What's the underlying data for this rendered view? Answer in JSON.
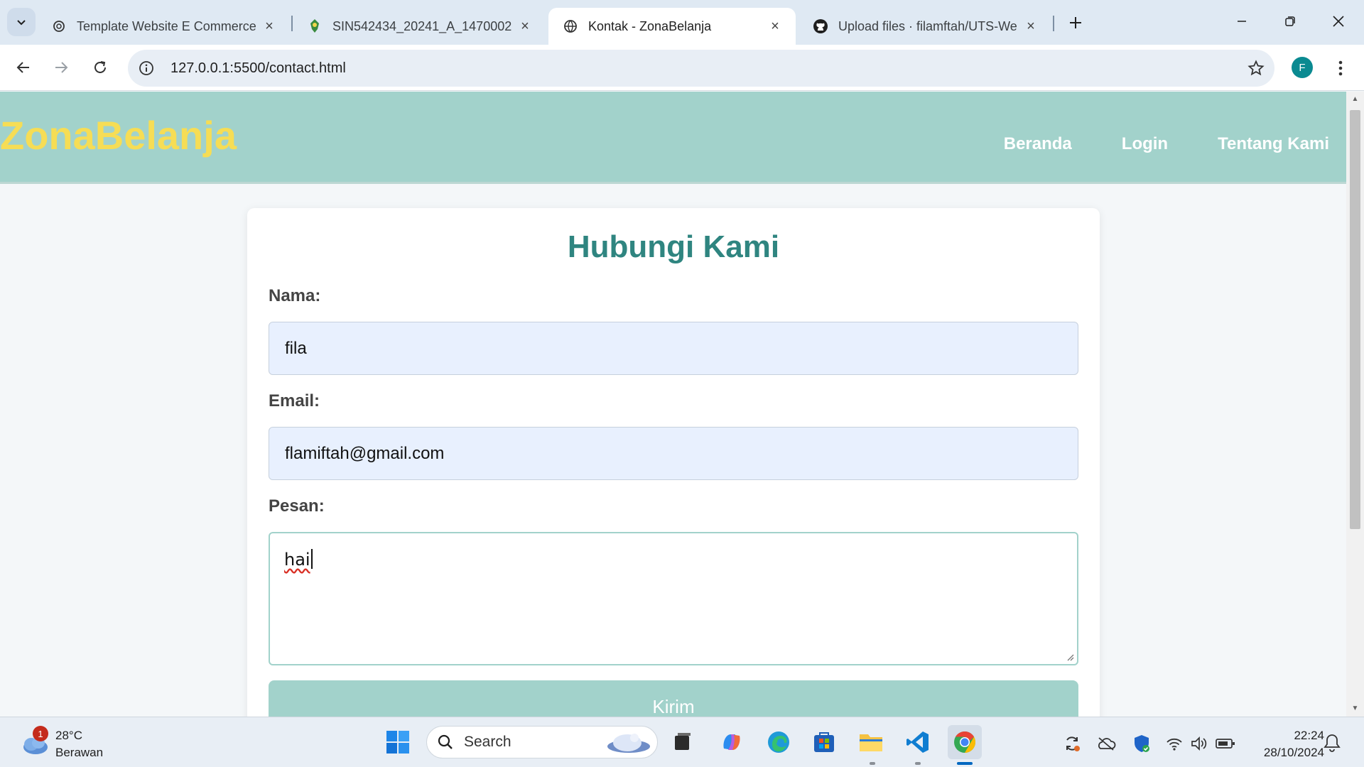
{
  "browser": {
    "tabs": [
      {
        "title": "Template Website E Commerce",
        "active": false,
        "icon": "openai-icon"
      },
      {
        "title": "SIN542434_20241_A_1470002",
        "active": false,
        "icon": "university-icon"
      },
      {
        "title": "Kontak - ZonaBelanja",
        "active": true,
        "icon": "globe-icon"
      },
      {
        "title": "Upload files · filamftah/UTS-We",
        "active": false,
        "icon": "github-icon"
      }
    ],
    "url": "127.0.0.1:5500/contact.html",
    "profile_initial": "F"
  },
  "site": {
    "brand": "ZonaBelanja",
    "nav": [
      "Beranda",
      "Login",
      "Tentang Kami"
    ],
    "colors": {
      "header_bg": "#a2d2cb",
      "brand": "#f6dd55",
      "heading": "#2f8580"
    }
  },
  "form": {
    "heading": "Hubungi Kami",
    "name_label": "Nama:",
    "name_value": "fila",
    "email_label": "Email:",
    "email_value": "flamiftah@gmail.com",
    "message_label": "Pesan:",
    "message_value": "hai",
    "submit_label": "Kirim"
  },
  "taskbar": {
    "weather_temp": "28°C",
    "weather_desc": "Berawan",
    "weather_badge": "1",
    "search_placeholder": "Search",
    "time": "22:24",
    "date": "28/10/2024"
  }
}
